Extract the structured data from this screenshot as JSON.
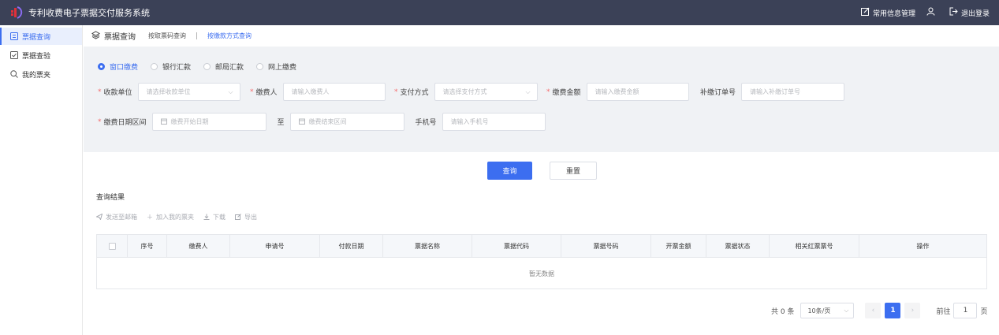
{
  "header": {
    "app_title": "专利收费电子票据交付服务系统",
    "info_manage": "常用信息管理",
    "logout": "退出登录"
  },
  "sidebar": {
    "items": [
      {
        "label": "票据查询",
        "icon": "grid-icon"
      },
      {
        "label": "票据查验",
        "icon": "check-square-icon"
      },
      {
        "label": "我的票夹",
        "icon": "search-icon"
      }
    ]
  },
  "breadcrumb": {
    "title": "票据查询",
    "link1": "按取票码查询",
    "sep": "|",
    "link2": "按缴款方式查询"
  },
  "payment_methods": [
    "窗口缴费",
    "银行汇款",
    "邮局汇款",
    "网上缴费"
  ],
  "form": {
    "receiver_label": "收款单位",
    "receiver_placeholder": "请选择收款单位",
    "payer_label": "缴费人",
    "payer_placeholder": "请输入缴费人",
    "paymode_label": "支付方式",
    "paymode_placeholder": "请选择支付方式",
    "amount_label": "缴费金额",
    "amount_placeholder": "请输入缴费金额",
    "supp_label": "补缴订单号",
    "supp_placeholder": "请输入补缴订单号",
    "date_label": "缴费日期区间",
    "date_start_placeholder": "缴费开始日期",
    "date_to": "至",
    "date_end_placeholder": "缴费结束区间",
    "phone_label": "手机号",
    "phone_placeholder": "请输入手机号"
  },
  "buttons": {
    "query": "查询",
    "reset": "重置"
  },
  "results": {
    "title": "查询结果",
    "actions": [
      "发送至邮箱",
      "加入我的票夹",
      "下载",
      "导出"
    ],
    "columns": [
      "序号",
      "缴费人",
      "申请号",
      "付款日期",
      "票据名称",
      "票据代码",
      "票据号码",
      "开票金额",
      "票据状态",
      "相关红票票号",
      "操作"
    ],
    "empty_text": "暂无数据"
  },
  "pagination": {
    "total": "共 0 条",
    "page_size": "10条/页",
    "current_page": "1",
    "goto_label": "前往",
    "goto_value": "1",
    "page_suffix": "页"
  },
  "colors": {
    "accent": "#3c6ef0",
    "header_bg": "#3b4157"
  }
}
